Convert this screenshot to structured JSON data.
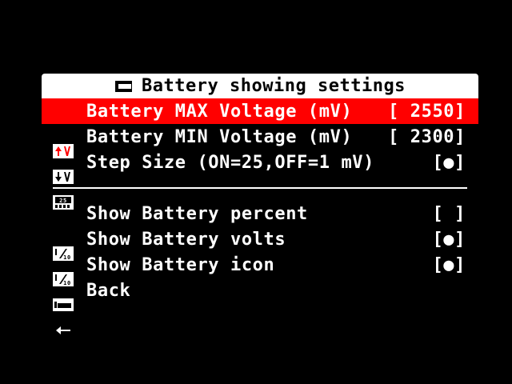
{
  "title": {
    "label": "Battery showing settings",
    "icon": "battery-icon"
  },
  "colors": {
    "background": "#000000",
    "title_bar": "#ffffff",
    "selection": "#ff0000",
    "text": "#ffffff"
  },
  "items": [
    {
      "label": "Battery MAX Voltage (mV)",
      "value": "[ 2550]",
      "icon": "voltage-up-icon",
      "selected": true
    },
    {
      "label": "Battery MIN Voltage (mV)",
      "value": "[ 2300]",
      "icon": "voltage-down-icon",
      "selected": false
    },
    {
      "label": "Step Size (ON=25,OFF=1 mV)",
      "value": "[●]",
      "icon": "step-size-icon",
      "selected": false
    },
    {
      "label": "Show Battery percent",
      "value": "[ ]",
      "icon": "fraction-icon",
      "selected": false
    },
    {
      "label": "Show Battery volts",
      "value": "[●]",
      "icon": "fraction-icon",
      "selected": false
    },
    {
      "label": "Show Battery icon",
      "value": "[●]",
      "icon": "battery-icon",
      "selected": false
    },
    {
      "label": "Back",
      "value": "",
      "icon": "back-arrow-icon",
      "selected": false
    }
  ]
}
